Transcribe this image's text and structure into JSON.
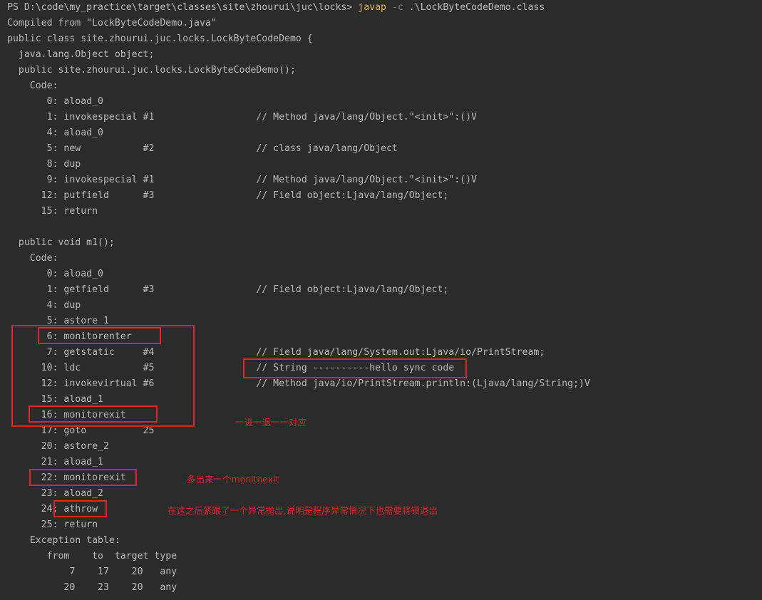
{
  "terminal": {
    "prompt": {
      "path": "PS D:\\code\\my_practice\\target\\classes\\site\\zhourui\\juc\\locks> ",
      "command": "javap",
      "flag": " -c ",
      "argument": ".\\LockByteCodeDemo.class"
    },
    "lines": [
      "Compiled from \"LockByteCodeDemo.java\"",
      "public class site.zhourui.juc.locks.LockByteCodeDemo {",
      "  java.lang.Object object;",
      "",
      "  public site.zhourui.juc.locks.LockByteCodeDemo();",
      "    Code:",
      "       0: aload_0",
      "       1: invokespecial #1                  // Method java/lang/Object.\"<init>\":()V",
      "       4: aload_0",
      "       5: new           #2                  // class java/lang/Object",
      "       8: dup",
      "       9: invokespecial #1                  // Method java/lang/Object.\"<init>\":()V",
      "      12: putfield      #3                  // Field object:Ljava/lang/Object;",
      "      15: return",
      "",
      "  public void m1();",
      "    Code:",
      "       0: aload_0",
      "       1: getfield      #3                  // Field object:Ljava/lang/Object;",
      "       4: dup",
      "       5: astore_1",
      "       6: monitorenter",
      "       7: getstatic     #4                  // Field java/lang/System.out:Ljava/io/PrintStream;",
      "      10: ldc           #5                  // String ----------hello sync code",
      "      12: invokevirtual #6                  // Method java/io/PrintStream.println:(Ljava/lang/String;)V",
      "      15: aload_1",
      "      16: monitorexit",
      "      17: goto          25",
      "      20: astore_2",
      "      21: aload_1",
      "      22: monitorexit",
      "      23: aload_2",
      "      24: athrow",
      "      25: return",
      "    Exception table:",
      "       from    to  target type",
      "           7    17    20   any",
      "          20    23    20   any"
    ]
  },
  "annotations": {
    "note_pairing": "一进一退一一对应",
    "note_extra_exit": "多出来一个monitoexit",
    "note_athrow": "在这之后紧跟了一个异常抛出,说明是程序异常情况下也需要将锁退出"
  },
  "colors": {
    "background": "#2b2b2b",
    "text": "#bbbbbb",
    "command": "#e8b84a",
    "flag": "#808080",
    "annotation": "#e0252a"
  }
}
